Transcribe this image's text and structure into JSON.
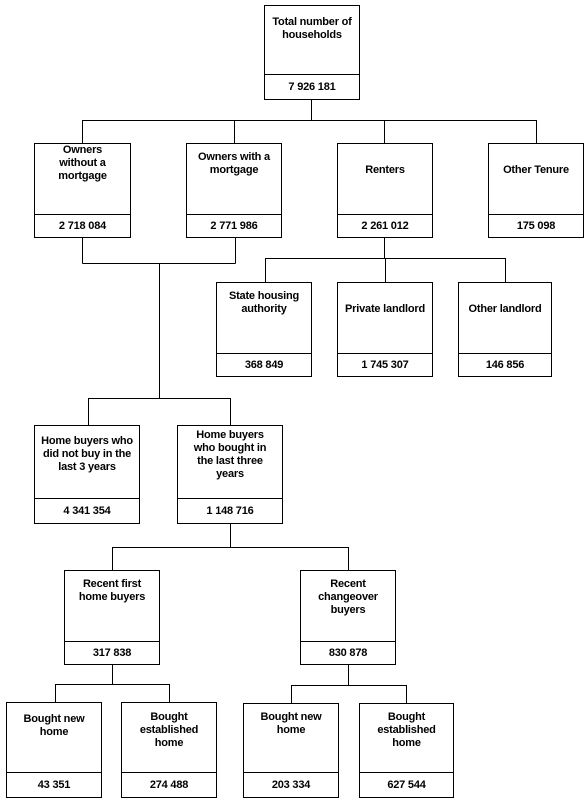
{
  "nodes": {
    "total": {
      "label": "Total number of households",
      "value": "7 926 181"
    },
    "owners_without_mortgage": {
      "label": "Owners without a mortgage",
      "value": "2 718 084"
    },
    "owners_with_mortgage": {
      "label": "Owners with a mortgage",
      "value": "2 771 986"
    },
    "renters": {
      "label": "Renters",
      "value": "2 261 012"
    },
    "other_tenure": {
      "label": "Other Tenure",
      "value": "175 098"
    },
    "state_housing": {
      "label": "State housing authority",
      "value": "368 849"
    },
    "private_landlord": {
      "label": "Private landlord",
      "value": "1 745 307"
    },
    "other_landlord": {
      "label": "Other landlord",
      "value": "146 856"
    },
    "not_recent_buyers": {
      "label": "Home buyers who did not buy in the last 3 years",
      "value": "4 341 354"
    },
    "recent_buyers": {
      "label": "Home buyers who bought in the last three years",
      "value": "1 148 716"
    },
    "recent_first": {
      "label": "Recent first home buyers",
      "value": "317 838"
    },
    "recent_changeover": {
      "label": "Recent changeover buyers",
      "value": "830 878"
    },
    "first_new": {
      "label": "Bought new home",
      "value": "43 351"
    },
    "first_established": {
      "label": "Bought established home",
      "value": "274 488"
    },
    "changeover_new": {
      "label": "Bought new home",
      "value": "203 334"
    },
    "changeover_established": {
      "label": "Bought established home",
      "value": "627 544"
    }
  }
}
